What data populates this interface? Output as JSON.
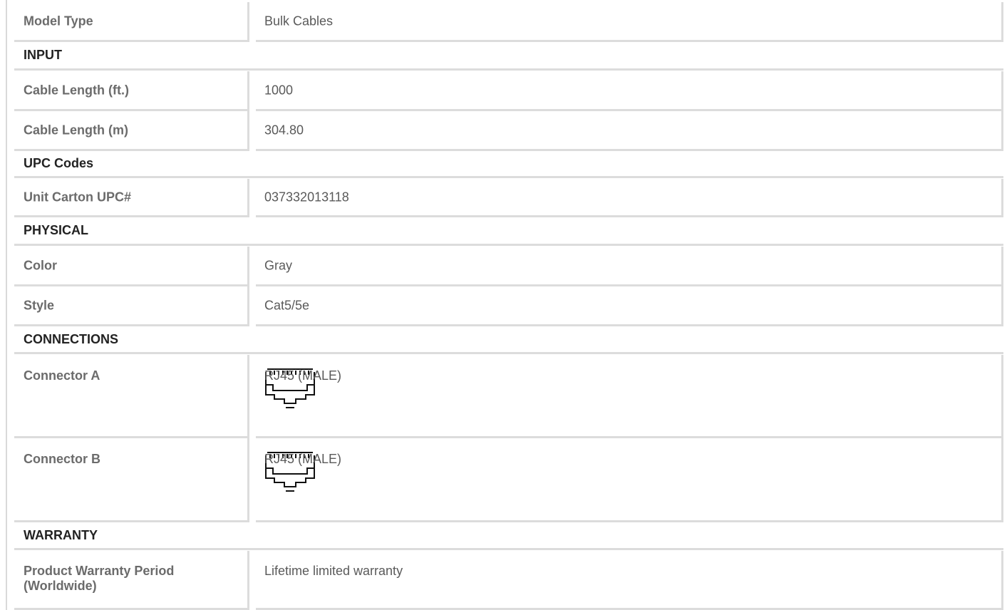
{
  "specs": {
    "model_type": {
      "label": "Model Type",
      "value": "Bulk Cables"
    },
    "input": {
      "title": "INPUT",
      "cable_length_ft": {
        "label": "Cable Length (ft.)",
        "value": "1000"
      },
      "cable_length_m": {
        "label": "Cable Length (m)",
        "value": "304.80"
      }
    },
    "upc": {
      "title": "UPC Codes",
      "unit_carton": {
        "label": "Unit Carton UPC#",
        "value": "037332013118"
      }
    },
    "physical": {
      "title": "PHYSICAL",
      "color": {
        "label": "Color",
        "value": "Gray"
      },
      "style": {
        "label": "Style",
        "value": "Cat5/5e"
      }
    },
    "connections": {
      "title": "CONNECTIONS",
      "connector_a": {
        "label": "Connector A",
        "value": "RJ45 (MALE)",
        "icon": "rj45-connector-icon"
      },
      "connector_b": {
        "label": "Connector B",
        "value": "RJ45 (MALE)",
        "icon": "rj45-connector-icon"
      }
    },
    "warranty": {
      "title": "WARRANTY",
      "period": {
        "label_line1": "Product Warranty Period",
        "label_line2": "(Worldwide)",
        "value": "Lifetime limited warranty"
      }
    }
  },
  "colors": {
    "border": "#dcdcdc",
    "label_text": "#6b6b6b",
    "section_text": "#222222",
    "value_text": "#5a5a5a"
  }
}
